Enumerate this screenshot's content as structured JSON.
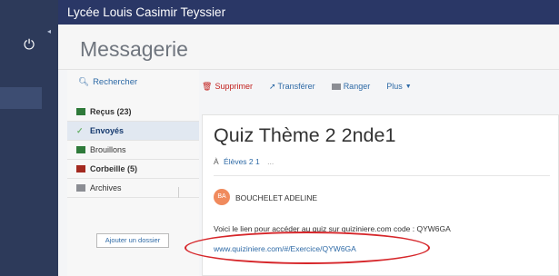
{
  "topbar": {
    "school_name": "Lycée Louis Casimir Teyssier"
  },
  "header": {
    "title": "Messagerie"
  },
  "sidebar": {
    "power_symbol": "⏻",
    "collapse_symbol": "◂"
  },
  "search": {
    "label": "Rechercher"
  },
  "folders": [
    {
      "label": "Reçus (23)",
      "icon": "inbox-icon"
    },
    {
      "label": "Envoyés",
      "icon": "sent-icon"
    },
    {
      "label": "Brouillons",
      "icon": "drafts-icon"
    },
    {
      "label": "Corbeille (5)",
      "icon": "trash-icon"
    },
    {
      "label": "Archives",
      "icon": "archive-icon"
    }
  ],
  "add_folder_label": "Ajouter un dossier",
  "toolbar": {
    "delete_label": "Supprimer",
    "forward_label": "Transférer",
    "archive_label": "Ranger",
    "more_label": "Plus"
  },
  "message": {
    "title": "Quiz Thème 2 2nde1",
    "to_prefix": "À",
    "recipients": "Élèves 2 1",
    "more_recipients": "...",
    "sender_initials": "BA",
    "sender_name": "BOUCHELET ADELINE",
    "body": "Voici le lien pour accéder au quiz sur quiziniere.com code : QYW6GA",
    "link": "www.quiziniere.com/#/Exercice/QYW6GA"
  },
  "colors": {
    "topbar_bg": "#2a3766",
    "sidebar_bg": "#2d3a5a",
    "accent_link": "#2e6aa6",
    "delete_red": "#c2221f",
    "annotation_red": "#d6262a"
  }
}
